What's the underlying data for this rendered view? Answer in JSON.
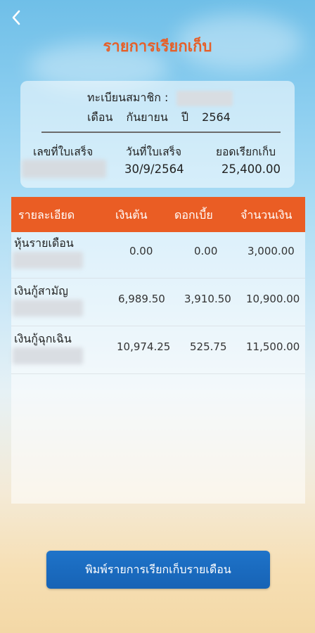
{
  "header": {
    "title": "รายการเรียกเก็บ"
  },
  "member": {
    "label": "ทะเบียนสมาชิก :",
    "month_label": "เดือน",
    "month_value": "กันยายน",
    "year_label": "ปี",
    "year_value": "2564"
  },
  "invoice": {
    "headers": {
      "number": "เลขที่ใบเสร็จ",
      "date": "วันที่ใบเสร็จ",
      "amount": "ยอดเรียกเก็บ"
    },
    "date": "30/9/2564",
    "amount": "25,400.00"
  },
  "table": {
    "headers": {
      "detail": "รายละเอียด",
      "principal": "เงินต้น",
      "interest": "ดอกเบี้ย",
      "total": "จำนวนเงิน"
    },
    "rows": [
      {
        "name": "หุ้นรายเดือน",
        "principal": "0.00",
        "interest": "0.00",
        "total": "3,000.00"
      },
      {
        "name": "เงินกู้สามัญ",
        "principal": "6,989.50",
        "interest": "3,910.50",
        "total": "10,900.00"
      },
      {
        "name": "เงินกู้ฉุกเฉิน",
        "principal": "10,974.25",
        "interest": "525.75",
        "total": "11,500.00"
      }
    ]
  },
  "actions": {
    "print_label": "พิมพ์รายการเรียกเก็บรายเดือน"
  },
  "colors": {
    "accent": "#e5602a",
    "header_bg": "#ea5d24",
    "button_bg": "#1763b5"
  }
}
